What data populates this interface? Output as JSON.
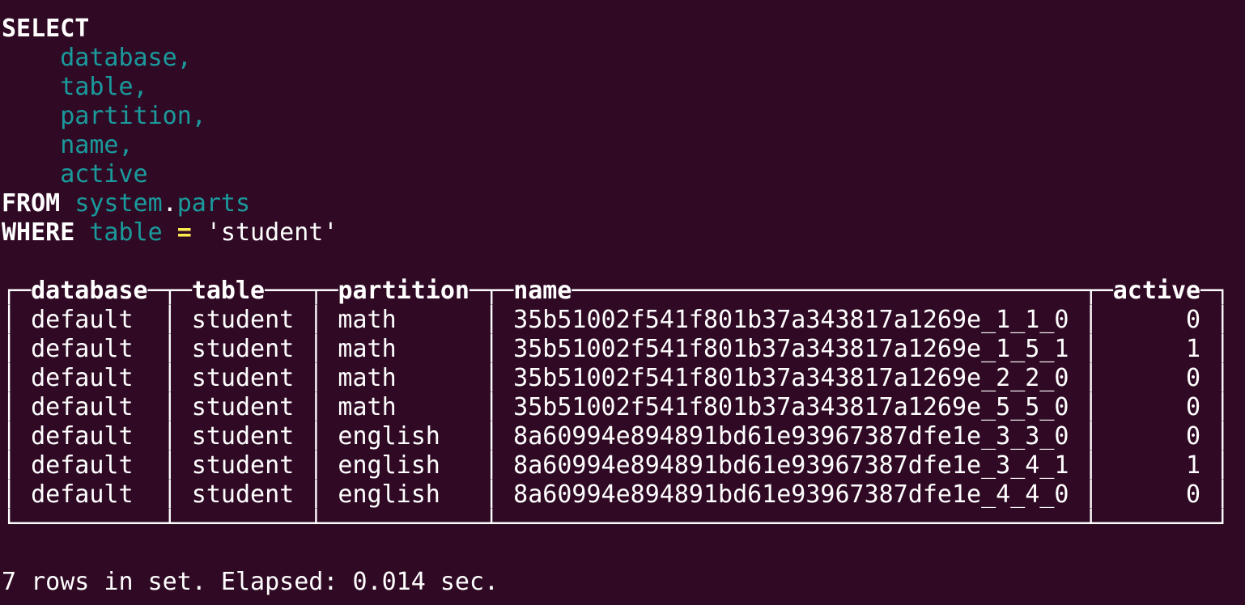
{
  "query": {
    "select_kw": "SELECT",
    "columns": [
      "database,",
      "table,",
      "partition,",
      "name,",
      "active"
    ],
    "from_kw": "FROM",
    "source_db": "system",
    "source_dot": ".",
    "source_table": "parts",
    "where_kw": "WHERE",
    "where_col": "table",
    "where_op": "=",
    "where_val": "'student'"
  },
  "result": {
    "headers": [
      "database",
      "table",
      "partition",
      "name",
      "active"
    ],
    "rows": [
      [
        "default",
        "student",
        "math",
        "35b51002f541f801b37a343817a1269e_1_1_0",
        "0"
      ],
      [
        "default",
        "student",
        "math",
        "35b51002f541f801b37a343817a1269e_1_5_1",
        "1"
      ],
      [
        "default",
        "student",
        "math",
        "35b51002f541f801b37a343817a1269e_2_2_0",
        "0"
      ],
      [
        "default",
        "student",
        "math",
        "35b51002f541f801b37a343817a1269e_5_5_0",
        "0"
      ],
      [
        "default",
        "student",
        "english",
        "8a60994e894891bd61e93967387dfe1e_3_3_0",
        "0"
      ],
      [
        "default",
        "student",
        "english",
        "8a60994e894891bd61e93967387dfe1e_3_4_1",
        "1"
      ],
      [
        "default",
        "student",
        "english",
        "8a60994e894891bd61e93967387dfe1e_4_4_0",
        "0"
      ]
    ]
  },
  "status": "7 rows in set. Elapsed: 0.014 sec.",
  "colors": {
    "background": "#300a24",
    "identifier": "#1a9a9c",
    "operator": "#fce94f",
    "text": "#ffffff"
  }
}
